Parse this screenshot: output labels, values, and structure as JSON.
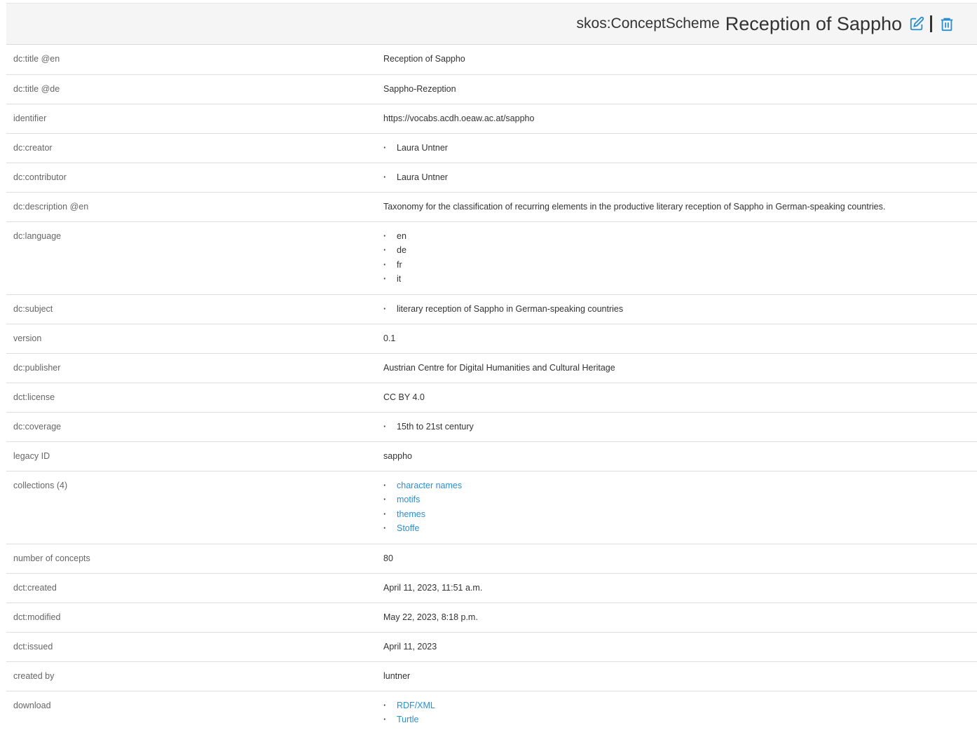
{
  "header": {
    "type_label": "skos:ConceptScheme",
    "title": "Reception of Sappho",
    "edit_icon": "edit-icon",
    "delete_icon": "trash-icon",
    "accent_color": "#2a8fcf"
  },
  "rows": {
    "title_en": {
      "key": "dc:title @en",
      "value": "Reception of Sappho"
    },
    "title_de": {
      "key": "dc:title @de",
      "value": "Sappho-Rezeption"
    },
    "identifier": {
      "key": "identifier",
      "value": "https://vocabs.acdh.oeaw.ac.at/sappho"
    },
    "creator": {
      "key": "dc:creator",
      "items": [
        "Laura Untner"
      ]
    },
    "contributor": {
      "key": "dc:contributor",
      "items": [
        "Laura Untner"
      ]
    },
    "description": {
      "key": "dc:description @en",
      "value": "Taxonomy for the classification of recurring elements in the productive literary reception of Sappho in German-speaking countries."
    },
    "language": {
      "key": "dc:language",
      "items": [
        "en",
        "de",
        "fr",
        "it"
      ]
    },
    "subject": {
      "key": "dc:subject",
      "items": [
        "literary reception of Sappho in German-speaking countries"
      ]
    },
    "version": {
      "key": "version",
      "value": "0.1"
    },
    "publisher": {
      "key": "dc:publisher",
      "value": "Austrian Centre for Digital Humanities and Cultural Heritage"
    },
    "license": {
      "key": "dct:license",
      "value": "CC BY 4.0"
    },
    "coverage": {
      "key": "dc:coverage",
      "items": [
        "15th to 21st century"
      ]
    },
    "legacy_id": {
      "key": "legacy ID",
      "value": "sappho"
    },
    "collections": {
      "key": "collections (4)",
      "items": [
        "character names",
        "motifs",
        "themes",
        "Stoffe"
      ]
    },
    "num_concepts": {
      "key": "number of concepts",
      "value": "80"
    },
    "created": {
      "key": "dct:created",
      "value": "April 11, 2023, 11:51 a.m."
    },
    "modified": {
      "key": "dct:modified",
      "value": "May 22, 2023, 8:18 p.m."
    },
    "issued": {
      "key": "dct:issued",
      "value": "April 11, 2023"
    },
    "created_by": {
      "key": "created by",
      "value": "luntner"
    },
    "download": {
      "key": "download",
      "items": [
        "RDF/XML",
        "Turtle"
      ]
    }
  }
}
